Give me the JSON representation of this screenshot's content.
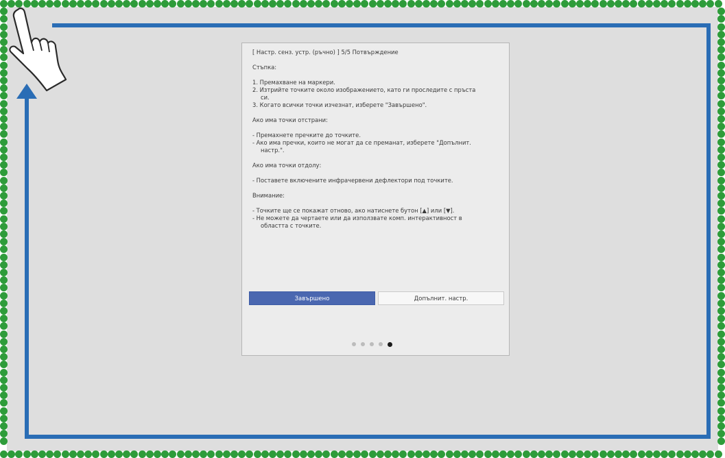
{
  "dialog": {
    "title": "[ Настр. сенз. устр. (ръчно) ]  5/5 Потвърждение",
    "steps_heading": "Стъпка:",
    "step1": "1. Премахване на маркери.",
    "step2": "2. Изтрийте точките около изображението, като ги проследите с пръста",
    "step2_cont": "си.",
    "step3": "3. Когато всички точки изчезнат, изберете \"Завършено\".",
    "sides_heading": "Ако има точки отстрани:",
    "sides_item1": "- Премахнете пречките до точките.",
    "sides_item2": "- Ако има пречки, които не могат да се преманат, изберете \"Допълнит.",
    "sides_item2_cont": "настр.\".",
    "below_heading": "Ако има точки отдолу:",
    "below_item1": "- Поставете включените инфрачервени дефлектори под точките.",
    "attention_heading": "Внимание:",
    "attention_item1": "- Точките ще се покажат отново, ако натиснете бутон [▲] или [▼].",
    "attention_item2": "- Не можете да чертаете или да използвате комп. интерактивност в",
    "attention_item2_cont": "областта с точките.",
    "finish_button": "Завършено",
    "more_settings_button": "Допълнит. настр.",
    "page_indicator": {
      "total": 5,
      "current": 5
    }
  },
  "colors": {
    "frame_dots": "#2e9c3a",
    "arrow": "#2a6db5",
    "primary_button": "#4a67b0"
  },
  "icons": {
    "hand": "hand-pointer-icon",
    "arrow": "up-arrow-icon"
  }
}
